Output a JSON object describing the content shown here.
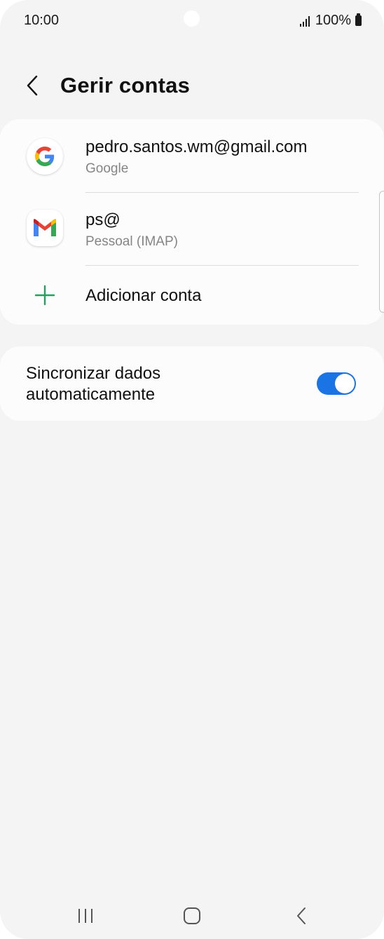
{
  "status_bar": {
    "time": "10:00",
    "battery": "100%",
    "icons": [
      "signal-icon",
      "battery-icon"
    ]
  },
  "header": {
    "title": "Gerir contas",
    "back_icon": "chevron-left-icon"
  },
  "accounts": [
    {
      "title": "pedro.santos.wm@gmail.com",
      "subtitle": "Google",
      "icon": "google-icon"
    },
    {
      "title": "ps@",
      "subtitle": "Pessoal (IMAP)",
      "icon": "gmail-icon"
    }
  ],
  "add_account": {
    "label": "Adicionar conta",
    "icon": "plus-icon"
  },
  "sync": {
    "label": "Sincronizar dados automaticamente",
    "enabled": true
  },
  "colors": {
    "accent": "#1b74e4",
    "add_green": "#1fa35c",
    "background": "#f4f4f4",
    "card": "#fcfcfc"
  },
  "nav_bar": {
    "buttons": [
      "recents-icon",
      "home-icon",
      "back-icon"
    ]
  }
}
